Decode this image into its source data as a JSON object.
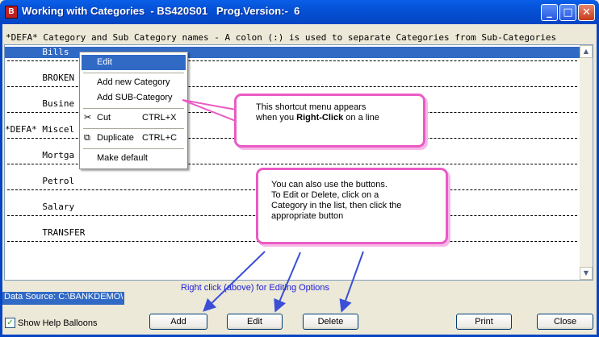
{
  "window": {
    "title": "Working with Categories  - BS420S01   Prog.Version:-  6",
    "icon_glyph": "B"
  },
  "title_buttons": {
    "minimize": "_",
    "maximize": "□",
    "close": "✕"
  },
  "list": {
    "header": "*DEFA* Category and Sub Category names - A colon (:) is used to separate Categories from Sub-Categories",
    "rows": [
      "       Bills",
      "       BROKEN",
      "       Busine",
      "*DEFA* Miscel",
      "       Mortga",
      "       Petrol",
      "       Salary",
      "       TRANSFER"
    ],
    "selected_index": 0
  },
  "context_menu": {
    "edit": "Edit",
    "add_new_category": "Add new Category",
    "add_sub_category": "Add SUB-Category",
    "cut": "Cut",
    "cut_shortcut": "CTRL+X",
    "duplicate": "Duplicate",
    "duplicate_shortcut": "CTRL+C",
    "make_default": "Make default",
    "cut_icon": "scissors-icon",
    "duplicate_icon": "copy-icon"
  },
  "callouts": {
    "menu_line1": "This shortcut menu appears",
    "menu_line2_pre": "when you ",
    "menu_line2_bold": "Right-Click",
    "menu_line2_post": " on a line",
    "buttons_line1": "You can also use the buttons.",
    "buttons_line2": "To Edit or Delete, click on a",
    "buttons_line3": "Category in the list, then click the",
    "buttons_line4": "appropriate button"
  },
  "footer": {
    "data_source": "Data Source: C:\\BANKDEMO\\",
    "help_text": "Right click (above) for Editing Options",
    "show_help_balloons": "Show Help Balloons",
    "show_help_checked": "✓"
  },
  "buttons": {
    "add": "Add",
    "edit": "Edit",
    "delete": "Delete",
    "print": "Print",
    "close": "Close"
  },
  "colors": {
    "titlebar": "#0345c3",
    "selection": "#316ac5",
    "callout_border": "#ea5bc4",
    "arrow": "#3b4fd6",
    "help_text": "#2020d8"
  }
}
